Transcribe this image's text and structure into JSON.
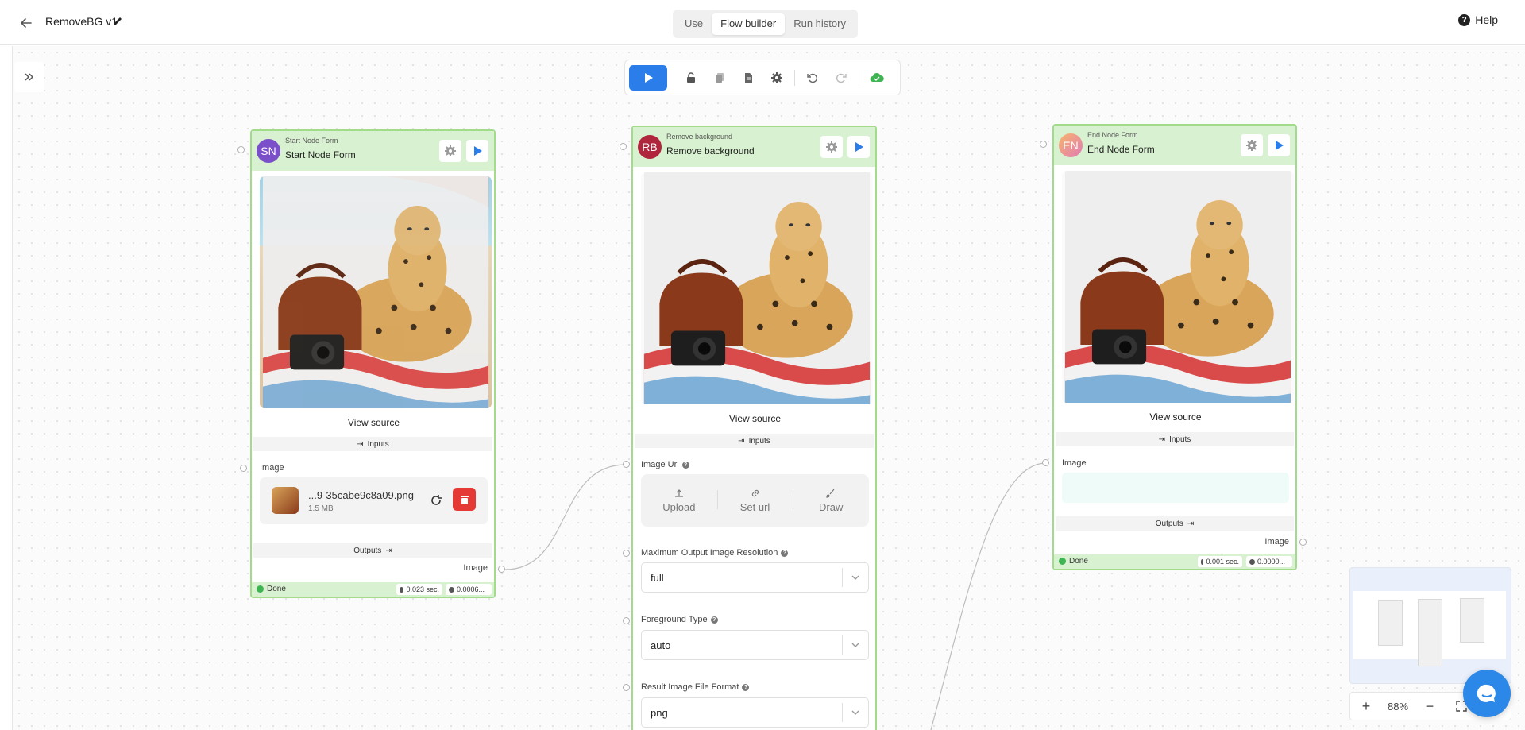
{
  "header": {
    "title": "RemoveBG v1",
    "tabs": [
      {
        "label": "Use"
      },
      {
        "label": "Flow builder",
        "active": true
      },
      {
        "label": "Run history"
      }
    ],
    "help_label": "Help"
  },
  "toolbar": {
    "icons": [
      "play-icon",
      "unlock-icon",
      "copy-icon",
      "document-icon",
      "gear-icon",
      "undo-icon",
      "redo-icon",
      "cloud-check-icon"
    ]
  },
  "nodes": {
    "start": {
      "avatar": "SN",
      "avatar_color": "#7b4fc9",
      "subtitle": "Start Node Form",
      "title": "Start Node Form",
      "view_source": "View source",
      "inputs_label": "Inputs",
      "field_label": "Image",
      "file_name": "...9-35cabe9c8a09.png",
      "file_size": "1.5 MB",
      "outputs_label": "Outputs",
      "output_name": "Image",
      "status": "Done",
      "time": "0.023 sec.",
      "cost": "0.0006..."
    },
    "remove": {
      "avatar": "RB",
      "avatar_color": "#b0263c",
      "subtitle": "Remove background",
      "title": "Remove background",
      "view_source": "View source",
      "inputs_label": "Inputs",
      "image_url_label": "Image Url",
      "source_options": [
        "Upload",
        "Set url",
        "Draw"
      ],
      "resolution_label": "Maximum Output Image Resolution",
      "resolution_value": "full",
      "foreground_label": "Foreground Type",
      "foreground_value": "auto",
      "format_label": "Result Image File Format",
      "format_value": "png"
    },
    "end": {
      "avatar": "EN",
      "avatar_color": "#e8a0c0",
      "subtitle": "End Node Form",
      "title": "End Node Form",
      "view_source": "View source",
      "inputs_label": "Inputs",
      "field_label": "Image",
      "outputs_label": "Outputs",
      "output_name": "Image",
      "status": "Done",
      "time": "0.001 sec.",
      "cost": "0.0000..."
    }
  },
  "zoom": {
    "value": "88%"
  },
  "colors": {
    "accent": "#2b7de9",
    "node_border": "#a2dc8a",
    "node_header": "#d8f1d0",
    "delete": "#e53935"
  }
}
